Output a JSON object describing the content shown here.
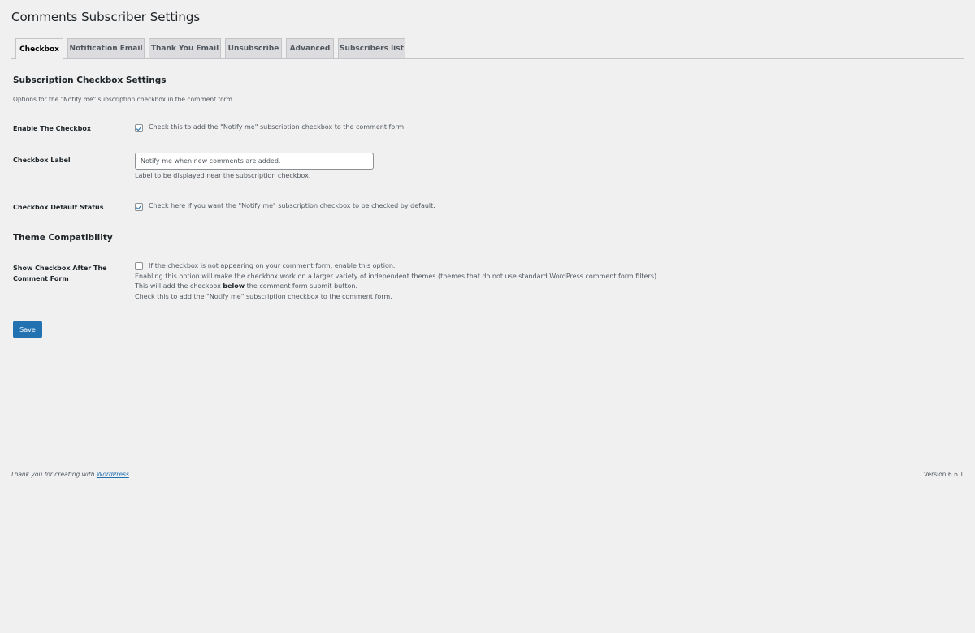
{
  "page": {
    "title": "Comments Subscriber Settings"
  },
  "tabs": [
    {
      "label": "Checkbox",
      "active": true
    },
    {
      "label": "Notification Email",
      "active": false
    },
    {
      "label": "Thank You Email",
      "active": false
    },
    {
      "label": "Unsubscribe",
      "active": false
    },
    {
      "label": "Advanced",
      "active": false
    },
    {
      "label": "Subscribers list",
      "active": false
    }
  ],
  "section1": {
    "heading": "Subscription Checkbox Settings",
    "description": "Options for the \"Notify me\" subscription checkbox in the comment form."
  },
  "fields": {
    "enable": {
      "label": "Enable The Checkbox",
      "checked": true,
      "text": "Check this to add the \"Notify me\" subscription checkbox to the comment form."
    },
    "label": {
      "label": "Checkbox Label",
      "value": "Notify me when new comments are added.",
      "help": "Label to be displayed near the subscription checkbox."
    },
    "default_status": {
      "label": "Checkbox Default Status",
      "checked": true,
      "text": "Check here if you want the \"Notify me\" subscription checkbox to be checked by default."
    }
  },
  "section2": {
    "heading": "Theme Compatibility"
  },
  "compat": {
    "label": "Show Checkbox After The Comment Form",
    "checked": false,
    "line1": "If the checkbox is not appearing on your comment form, enable this option.",
    "line2": "Enabling this option will make the checkbox work on a larger variety of independent themes (themes that do not use standard WordPress comment form filters).",
    "line3_pre": "This will add the checkbox ",
    "line3_bold": "below",
    "line3_post": " the comment form submit button.",
    "line4": "Check this to add the \"Notify me\" subscription checkbox to the comment form."
  },
  "actions": {
    "save_label": "Save"
  },
  "footer": {
    "thanks_prefix": "Thank you for creating with ",
    "thanks_link": "WordPress",
    "thanks_suffix": ".",
    "version": "Version 6.6.1"
  },
  "colors": {
    "accent": "#2271b1",
    "background": "#f0f0f1",
    "text": "#1d2327"
  }
}
